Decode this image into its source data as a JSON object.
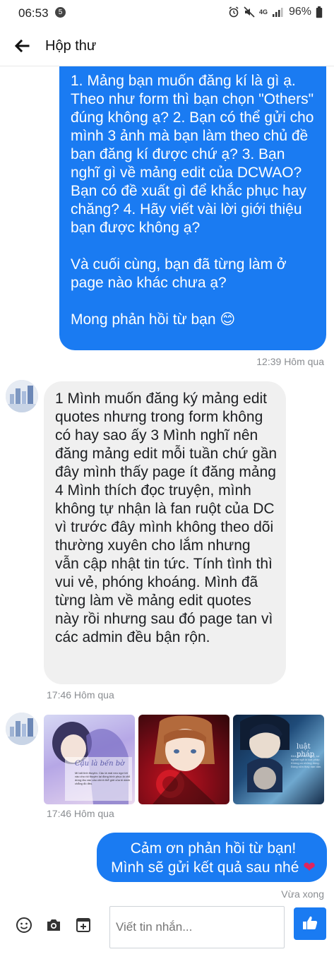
{
  "status_bar": {
    "time": "06:53",
    "notification_count": "5",
    "battery": "96%",
    "network": "4G"
  },
  "header": {
    "title": "Hộp thư",
    "back_icon": "arrow-left-icon"
  },
  "messages": {
    "outgoing_1": {
      "text": " 1. Mảng bạn muốn đăng kí là gì ạ. Theo như form thì bạn chọn \"Others\" đúng không ạ? 2. Bạn có thể gửi cho mình 3 ảnh mà bạn làm theo chủ đề bạn đăng kí được chứ ạ? 3. Bạn nghĩ gì về mảng edit của DCWAO? Bạn có đề xuất gì để khắc phục hay chăng? 4. Hãy viết vài lời giới thiệu bạn được không ạ?\n\n Và cuối cùng, bạn đã từng làm ở page nào khác chưa ạ?\n\n Mong phản hồi từ bạn 😊",
      "time": "12:39 Hôm qua"
    },
    "incoming_1": {
      "text": "1 Mình muốn đăng ký mảng edit quotes nhưng trong form không có hay sao ấy 3 Mình nghĩ nên đăng mảng edit mỗi tuần chứ gần đây mình thấy page ít đăng mảng 4 Mình thích đọc truyện, mình không tự nhận là fan ruột của DC vì trước đây mình không theo dõi thường xuyên cho lắm nhưng vẫn cập nhật tin tức. Tính tình thì vui vẻ, phóng khoáng. Mình đã từng làm về mảng edit quotes này rồi nhưng sau đó page tan vì các admin đều bận rộn.",
      "time": "17:46 Hôm qua"
    },
    "incoming_images": {
      "time": "17:46 Hôm qua",
      "images": [
        {
          "caption_title": "Cậu là bến bờ",
          "caption_text": "Mi bất tình thuyền. Cậu là mái neo ngơ tới vào cho rồi thuyền lại đồng bình phục là chỗ dừng lâu vào vào chính thể giới của bi dành chẳng đồ đều."
        },
        {
          "caption_title": "",
          "caption_text": ""
        },
        {
          "caption_title": "luật pháp",
          "caption_text": "Kinh tâm đạo dụng, sự nghiệt ngã là luật pháp. Không có những đúng. Đúng nữa thay dạn dặn."
        }
      ]
    },
    "outgoing_2": {
      "line1": "Cảm ơn phản hồi từ bạn!",
      "line2": "Mình sẽ gửi kết quả sau nhé",
      "heart": "❤",
      "time": "Vừa xong"
    }
  },
  "composer": {
    "placeholder": "Viết tin nhắn...",
    "icons": [
      "emoji-icon",
      "camera-icon",
      "add-icon",
      "like-icon"
    ]
  },
  "colors": {
    "accent": "#1a7bf2",
    "incoming_bubble": "#f0f0f0",
    "timestamp": "#8a8d91"
  }
}
